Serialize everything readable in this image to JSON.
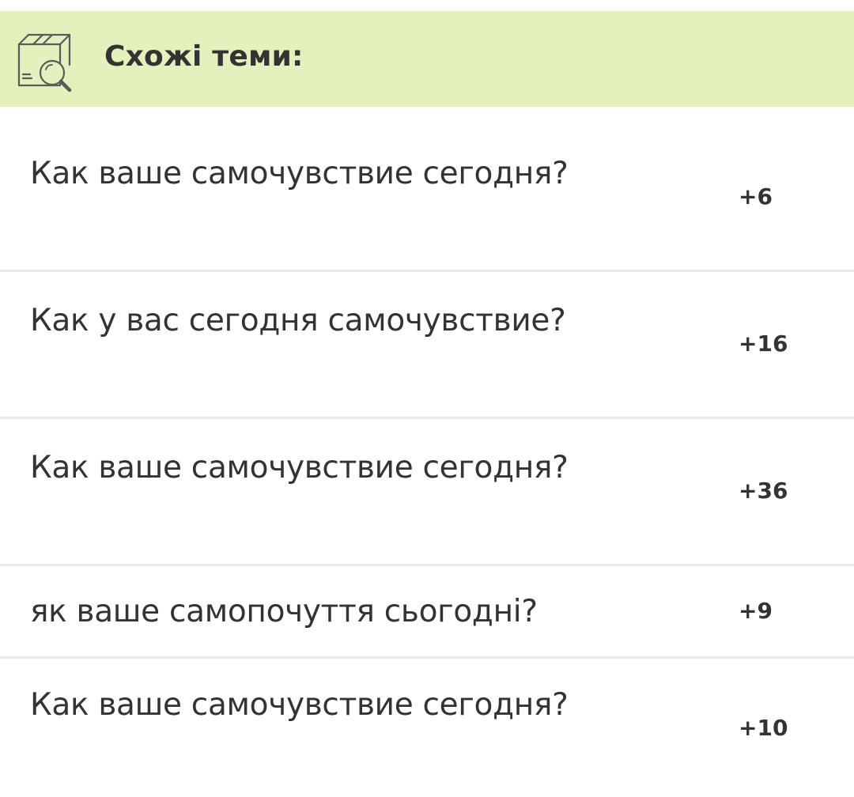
{
  "header": {
    "icon": "box-search-icon",
    "title": "Схожі теми:",
    "background": "#e3f2bd"
  },
  "topics": [
    {
      "title": "Как ваше самочувствие сегодня?",
      "count": "+6"
    },
    {
      "title": "Как у вас сегодня самочувствие?",
      "count": "+16"
    },
    {
      "title": "Как ваше самочувствие сегодня?",
      "count": "+36"
    },
    {
      "title": "як ваше самопочуття сьогодні?",
      "count": "+9"
    },
    {
      "title": "Как ваше самочувствие сегодня?",
      "count": "+10"
    }
  ]
}
